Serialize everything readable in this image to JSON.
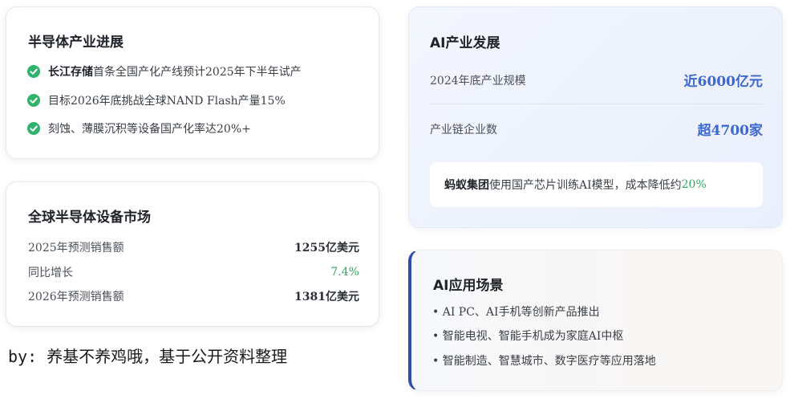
{
  "semiconductor": {
    "title": "半导体产业进展",
    "items": [
      {
        "strong": "长江存储",
        "text": "首条全国产化产线预计2025年下半年试产"
      },
      {
        "strong": "",
        "text": "目标2026年底挑战全球NAND Flash产量15%"
      },
      {
        "strong": "",
        "text": "刻蚀、薄膜沉积等设备国产化率达20%+"
      }
    ]
  },
  "market": {
    "title": "全球半导体设备市场",
    "rows": [
      {
        "label": "2025年预测销售额",
        "value": "1255亿美元"
      },
      {
        "label": "同比增长",
        "value": "7.4%"
      },
      {
        "label": "2026年预测销售额",
        "value": "1381亿美元"
      }
    ]
  },
  "credit": "by: 养基不养鸡哦，基于公开资料整理",
  "ai_industry": {
    "title": "AI产业发展",
    "rows": [
      {
        "label": "2024年底产业规模",
        "value": "近6000亿元"
      },
      {
        "label": "产业链企业数",
        "value": "超4700家"
      }
    ],
    "note": {
      "strong": "蚂蚁集团",
      "text": "使用国产芯片训练AI模型，成本降低约",
      "highlight": "20%"
    }
  },
  "ai_apps": {
    "title": "AI应用场景",
    "items": [
      "• AI PC、AI手机等创新产品推出",
      "• 智能电视、智能手机成为家庭AI中枢",
      "• 智能制造、智慧城市、数字医疗等应用落地"
    ]
  },
  "colors": {
    "check_green": "#2fb36a",
    "growth_green": "#2fa85f",
    "value_blue": "#3d68cf",
    "accent_bar": "#2f4eaa"
  }
}
